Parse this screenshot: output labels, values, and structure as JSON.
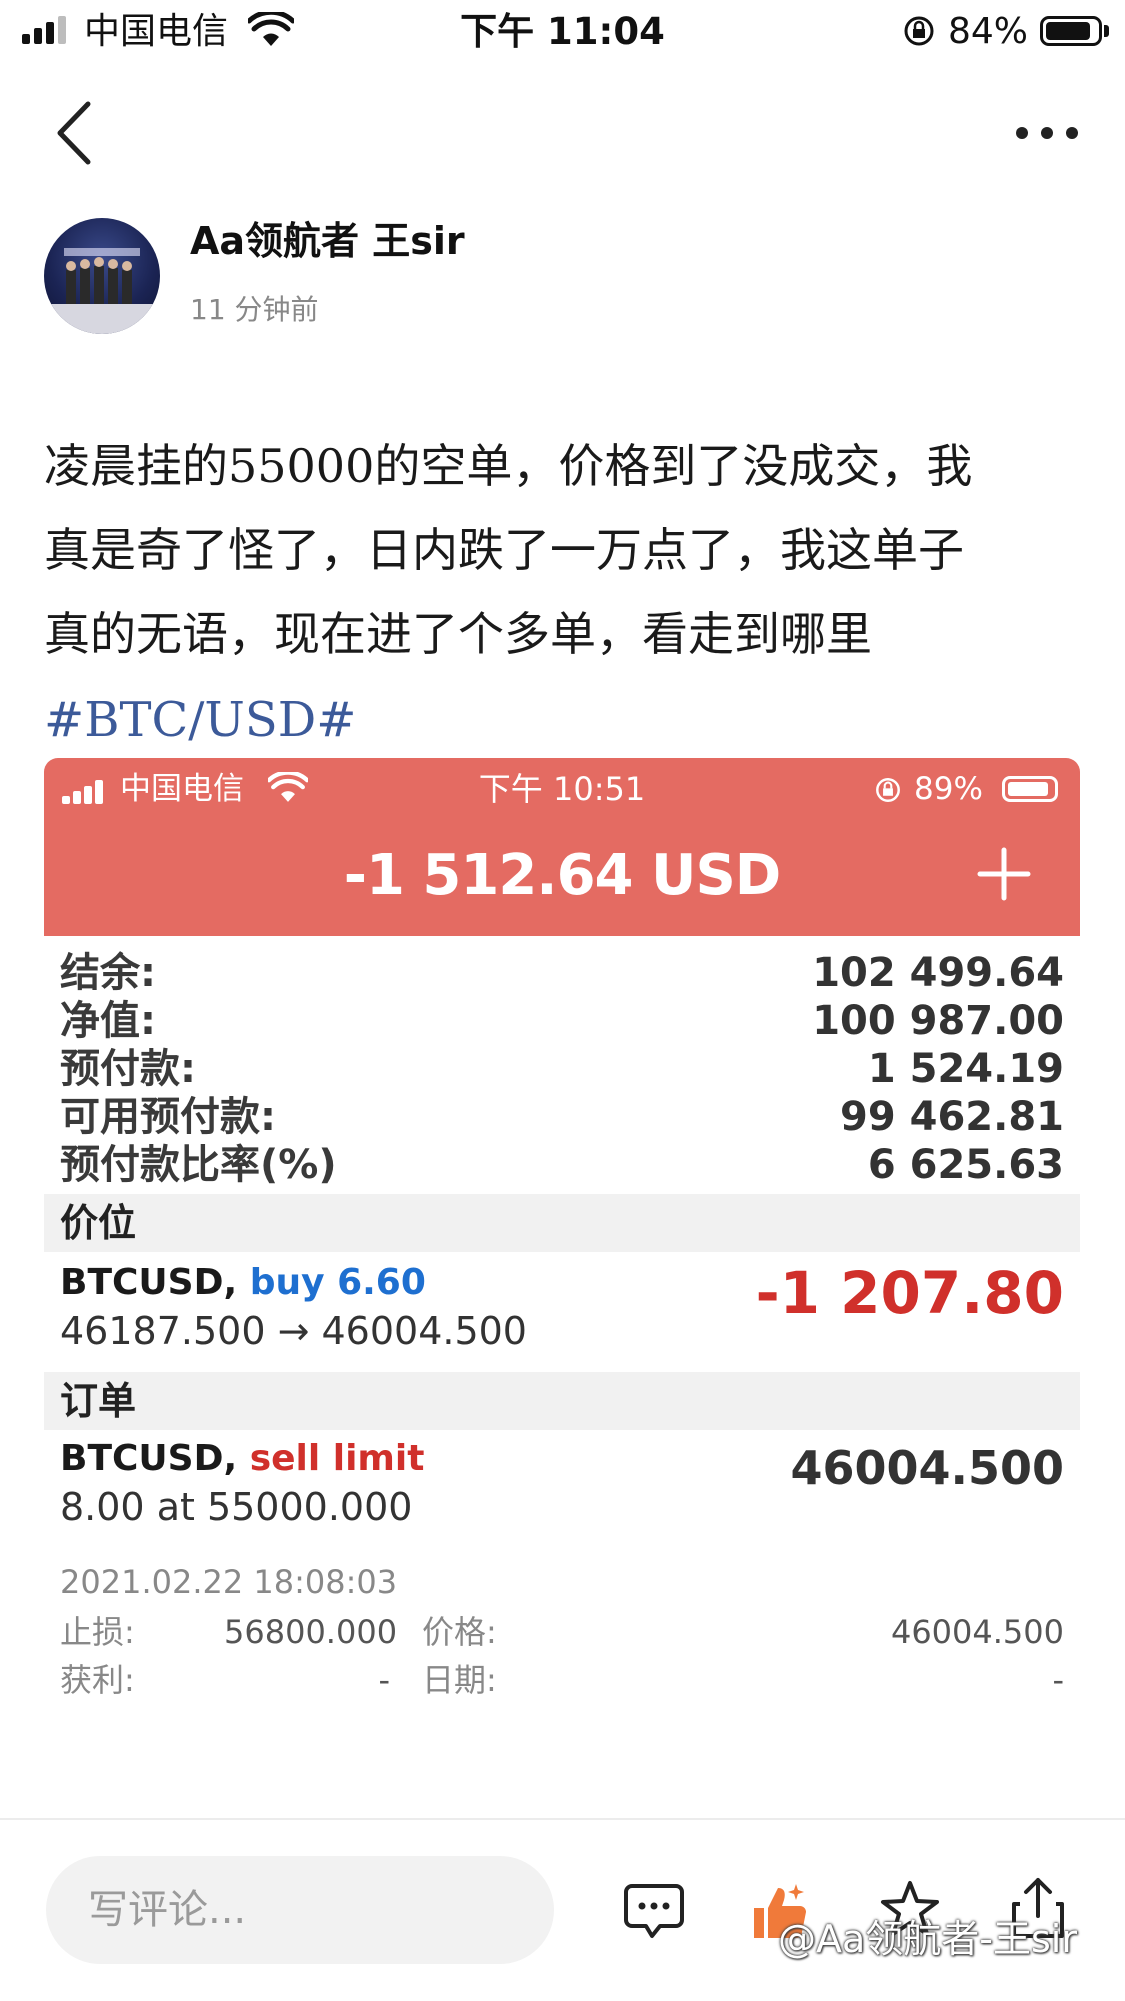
{
  "status_bar": {
    "carrier": "中国电信",
    "time": "下午 11:04",
    "battery": "84%",
    "battery_level": 0.84
  },
  "nav": {
    "back_icon": "chevron-left-icon",
    "more_icon": "more-dots-icon"
  },
  "post": {
    "author": "Aa领航者 王sir",
    "time_ago": "11 分钟前",
    "text_lines": [
      "凌晨挂的55000的空单，价格到了没成交，我",
      "真是奇了怪了，日内跌了一万点了，我这单子",
      "真的无语，现在进了个多单，看走到哪里"
    ],
    "hashtag": "#BTC/USD#"
  },
  "screenshot": {
    "status_bar": {
      "carrier": "中国电信",
      "time": "下午 10:51",
      "battery": "89%",
      "battery_level": 0.89
    },
    "header_value": "-1 512.64 USD",
    "header_color": "#e46b62",
    "account": [
      {
        "label": "结余:",
        "value": "102 499.64"
      },
      {
        "label": "净值:",
        "value": "100 987.00"
      },
      {
        "label": "预付款:",
        "value": "1 524.19"
      },
      {
        "label": "可用预付款:",
        "value": "99 462.81"
      },
      {
        "label": "预付款比率(%)",
        "value": "6 625.63"
      }
    ],
    "positions_title": "价位",
    "position": {
      "symbol": "BTCUSD,",
      "side": "buy 6.60",
      "prices": "46187.500 → 46004.500",
      "profit": "-1 207.80"
    },
    "orders_title": "订单",
    "order": {
      "symbol": "BTCUSD,",
      "type": "sell limit",
      "detail": "8.00 at 55000.000",
      "price": "46004.500",
      "date": "2021.02.22 18:08:03",
      "sl_label": "止损:",
      "sl_value": "56800.000",
      "tp_label": "获利:",
      "tp_value": "-",
      "price_label": "价格:",
      "price_value": "46004.500",
      "date_label": "日期:",
      "date_value": "-"
    }
  },
  "bottom_bar": {
    "comment_placeholder": "写评论...",
    "icons": [
      "comment-icon",
      "like-icon",
      "star-icon",
      "share-icon"
    ],
    "like_color": "#f07a3a"
  },
  "watermark": "@Aa领航者-王sir"
}
